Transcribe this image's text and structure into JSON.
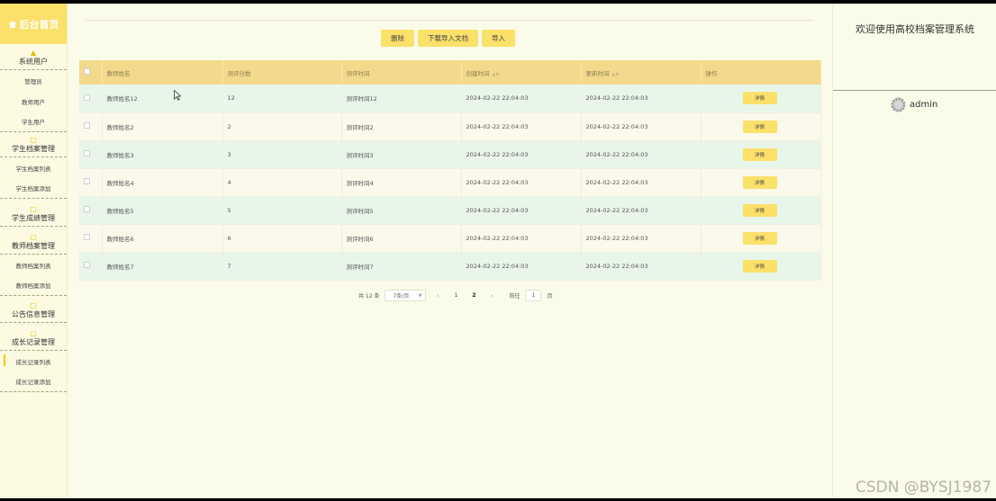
{
  "sidebar": {
    "home": "后台首页",
    "groups": [
      {
        "title": "系统用户",
        "items": [
          "管理员",
          "教师用户",
          "学生用户"
        ]
      },
      {
        "title": "学生档案管理",
        "items": [
          "学生档案列表",
          "学生档案添加"
        ]
      },
      {
        "title": "学生成绩管理",
        "items": []
      },
      {
        "title": "教师档案管理",
        "items": [
          "教师档案列表",
          "教师档案添加"
        ]
      },
      {
        "title": "公告信息管理",
        "items": []
      },
      {
        "title": "成长记录管理",
        "items": [
          "成长记录列表",
          "成长记录添加"
        ]
      }
    ],
    "active_item": "成长记录列表"
  },
  "toolbar": {
    "delete": "删除",
    "download_template": "下载导入文档",
    "import": "导入"
  },
  "table": {
    "headers": [
      "教师姓名",
      "测评分数",
      "测评时间",
      "创建时间",
      "更新时间",
      "操作"
    ],
    "detail_label": "详情",
    "rows": [
      [
        "教师姓名12",
        "12",
        "测评时间12",
        "2024-02-22 22:04:03",
        "2024-02-22 22:04:03"
      ],
      [
        "教师姓名2",
        "2",
        "测评时间2",
        "2024-02-22 22:04:03",
        "2024-02-22 22:04:03"
      ],
      [
        "教师姓名3",
        "3",
        "测评时间3",
        "2024-02-22 22:04:03",
        "2024-02-22 22:04:03"
      ],
      [
        "教师姓名4",
        "4",
        "测评时间4",
        "2024-02-22 22:04:03",
        "2024-02-22 22:04:03"
      ],
      [
        "教师姓名5",
        "5",
        "测评时间5",
        "2024-02-22 22:04:03",
        "2024-02-22 22:04:03"
      ],
      [
        "教师姓名6",
        "6",
        "测评时间6",
        "2024-02-22 22:04:03",
        "2024-02-22 22:04:03"
      ],
      [
        "教师姓名7",
        "7",
        "测评时间7",
        "2024-02-22 22:04:03",
        "2024-02-22 22:04:03"
      ]
    ]
  },
  "pagination": {
    "total": "共 12 条",
    "page_size": "7条/页",
    "pages": [
      "1",
      "2"
    ],
    "current": "2",
    "goto_prefix": "前往",
    "goto_value": "1",
    "goto_suffix": "页"
  },
  "right": {
    "welcome": "欢迎使用高校档案管理系统",
    "username": "admin"
  },
  "watermark": "CSDN @BYSJ1987",
  "colors": {
    "accent": "#fbe06a",
    "header": "#f3d98c",
    "row_odd": "#e8f6ea",
    "row_even": "#fbf8ec"
  }
}
